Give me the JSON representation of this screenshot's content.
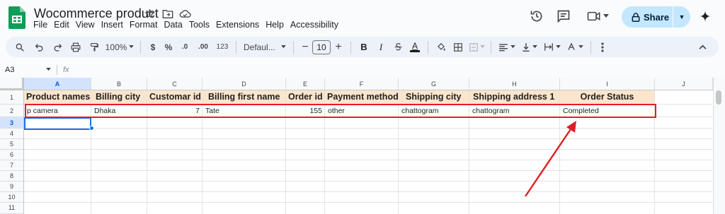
{
  "document": {
    "title": "Wocommerce product"
  },
  "menu": [
    "File",
    "Edit",
    "View",
    "Insert",
    "Format",
    "Data",
    "Tools",
    "Extensions",
    "Help",
    "Accessibility"
  ],
  "share": {
    "label": "Share"
  },
  "toolbar": {
    "zoom": "100%",
    "currency": "$",
    "percent": "%",
    "decrease_decimal": ".0",
    "increase_decimal": ".00",
    "number_format": "123",
    "font": "Defaul...",
    "font_size": "10",
    "bold": "B",
    "italic": "I",
    "text_color": "A"
  },
  "formula_bar": {
    "cell_ref": "A3",
    "fx": "fx"
  },
  "columns": [
    "A",
    "B",
    "C",
    "D",
    "E",
    "F",
    "G",
    "H",
    "I",
    "J"
  ],
  "rows": [
    "1",
    "2",
    "3",
    "4",
    "5",
    "6",
    "7",
    "8",
    "9",
    "10",
    "11"
  ],
  "headers": [
    "Product names",
    "Billing city",
    "Customar id",
    "Billing first name",
    "Order id",
    "Payment method",
    "Shipping city",
    "Shipping address 1",
    "Order Status"
  ],
  "record": [
    "p camera",
    "Dhaka",
    "7",
    "Tate",
    "155",
    "other",
    "chattogram",
    "chattogram",
    "Completed"
  ],
  "colors": {
    "header_fill": "#fce5cd",
    "selection": "#1a73e8",
    "annotation": "#e01e26",
    "share_button": "#c2e7ff",
    "sheets_green": "#0f9d58"
  }
}
